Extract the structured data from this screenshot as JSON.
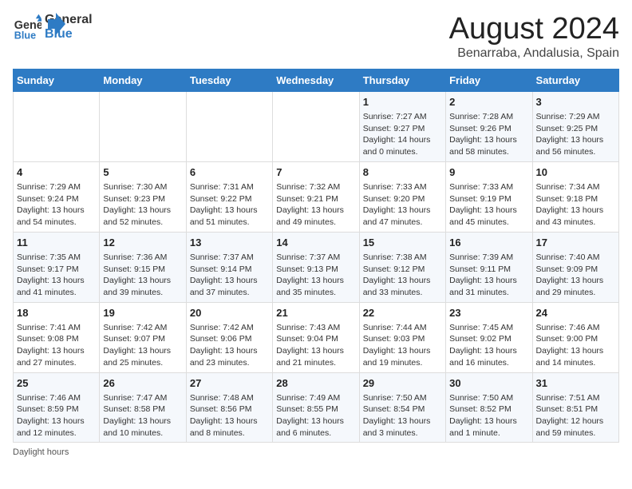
{
  "header": {
    "logo_line1": "General",
    "logo_line2": "Blue",
    "title": "August 2024",
    "subtitle": "Benarraba, Andalusia, Spain"
  },
  "days_of_week": [
    "Sunday",
    "Monday",
    "Tuesday",
    "Wednesday",
    "Thursday",
    "Friday",
    "Saturday"
  ],
  "weeks": [
    [
      {
        "day": "",
        "info": ""
      },
      {
        "day": "",
        "info": ""
      },
      {
        "day": "",
        "info": ""
      },
      {
        "day": "",
        "info": ""
      },
      {
        "day": "1",
        "info": "Sunrise: 7:27 AM\nSunset: 9:27 PM\nDaylight: 14 hours and 0 minutes."
      },
      {
        "day": "2",
        "info": "Sunrise: 7:28 AM\nSunset: 9:26 PM\nDaylight: 13 hours and 58 minutes."
      },
      {
        "day": "3",
        "info": "Sunrise: 7:29 AM\nSunset: 9:25 PM\nDaylight: 13 hours and 56 minutes."
      }
    ],
    [
      {
        "day": "4",
        "info": "Sunrise: 7:29 AM\nSunset: 9:24 PM\nDaylight: 13 hours and 54 minutes."
      },
      {
        "day": "5",
        "info": "Sunrise: 7:30 AM\nSunset: 9:23 PM\nDaylight: 13 hours and 52 minutes."
      },
      {
        "day": "6",
        "info": "Sunrise: 7:31 AM\nSunset: 9:22 PM\nDaylight: 13 hours and 51 minutes."
      },
      {
        "day": "7",
        "info": "Sunrise: 7:32 AM\nSunset: 9:21 PM\nDaylight: 13 hours and 49 minutes."
      },
      {
        "day": "8",
        "info": "Sunrise: 7:33 AM\nSunset: 9:20 PM\nDaylight: 13 hours and 47 minutes."
      },
      {
        "day": "9",
        "info": "Sunrise: 7:33 AM\nSunset: 9:19 PM\nDaylight: 13 hours and 45 minutes."
      },
      {
        "day": "10",
        "info": "Sunrise: 7:34 AM\nSunset: 9:18 PM\nDaylight: 13 hours and 43 minutes."
      }
    ],
    [
      {
        "day": "11",
        "info": "Sunrise: 7:35 AM\nSunset: 9:17 PM\nDaylight: 13 hours and 41 minutes."
      },
      {
        "day": "12",
        "info": "Sunrise: 7:36 AM\nSunset: 9:15 PM\nDaylight: 13 hours and 39 minutes."
      },
      {
        "day": "13",
        "info": "Sunrise: 7:37 AM\nSunset: 9:14 PM\nDaylight: 13 hours and 37 minutes."
      },
      {
        "day": "14",
        "info": "Sunrise: 7:37 AM\nSunset: 9:13 PM\nDaylight: 13 hours and 35 minutes."
      },
      {
        "day": "15",
        "info": "Sunrise: 7:38 AM\nSunset: 9:12 PM\nDaylight: 13 hours and 33 minutes."
      },
      {
        "day": "16",
        "info": "Sunrise: 7:39 AM\nSunset: 9:11 PM\nDaylight: 13 hours and 31 minutes."
      },
      {
        "day": "17",
        "info": "Sunrise: 7:40 AM\nSunset: 9:09 PM\nDaylight: 13 hours and 29 minutes."
      }
    ],
    [
      {
        "day": "18",
        "info": "Sunrise: 7:41 AM\nSunset: 9:08 PM\nDaylight: 13 hours and 27 minutes."
      },
      {
        "day": "19",
        "info": "Sunrise: 7:42 AM\nSunset: 9:07 PM\nDaylight: 13 hours and 25 minutes."
      },
      {
        "day": "20",
        "info": "Sunrise: 7:42 AM\nSunset: 9:06 PM\nDaylight: 13 hours and 23 minutes."
      },
      {
        "day": "21",
        "info": "Sunrise: 7:43 AM\nSunset: 9:04 PM\nDaylight: 13 hours and 21 minutes."
      },
      {
        "day": "22",
        "info": "Sunrise: 7:44 AM\nSunset: 9:03 PM\nDaylight: 13 hours and 19 minutes."
      },
      {
        "day": "23",
        "info": "Sunrise: 7:45 AM\nSunset: 9:02 PM\nDaylight: 13 hours and 16 minutes."
      },
      {
        "day": "24",
        "info": "Sunrise: 7:46 AM\nSunset: 9:00 PM\nDaylight: 13 hours and 14 minutes."
      }
    ],
    [
      {
        "day": "25",
        "info": "Sunrise: 7:46 AM\nSunset: 8:59 PM\nDaylight: 13 hours and 12 minutes."
      },
      {
        "day": "26",
        "info": "Sunrise: 7:47 AM\nSunset: 8:58 PM\nDaylight: 13 hours and 10 minutes."
      },
      {
        "day": "27",
        "info": "Sunrise: 7:48 AM\nSunset: 8:56 PM\nDaylight: 13 hours and 8 minutes."
      },
      {
        "day": "28",
        "info": "Sunrise: 7:49 AM\nSunset: 8:55 PM\nDaylight: 13 hours and 6 minutes."
      },
      {
        "day": "29",
        "info": "Sunrise: 7:50 AM\nSunset: 8:54 PM\nDaylight: 13 hours and 3 minutes."
      },
      {
        "day": "30",
        "info": "Sunrise: 7:50 AM\nSunset: 8:52 PM\nDaylight: 13 hours and 1 minute."
      },
      {
        "day": "31",
        "info": "Sunrise: 7:51 AM\nSunset: 8:51 PM\nDaylight: 12 hours and 59 minutes."
      }
    ]
  ],
  "footer": {
    "daylight_label": "Daylight hours"
  }
}
